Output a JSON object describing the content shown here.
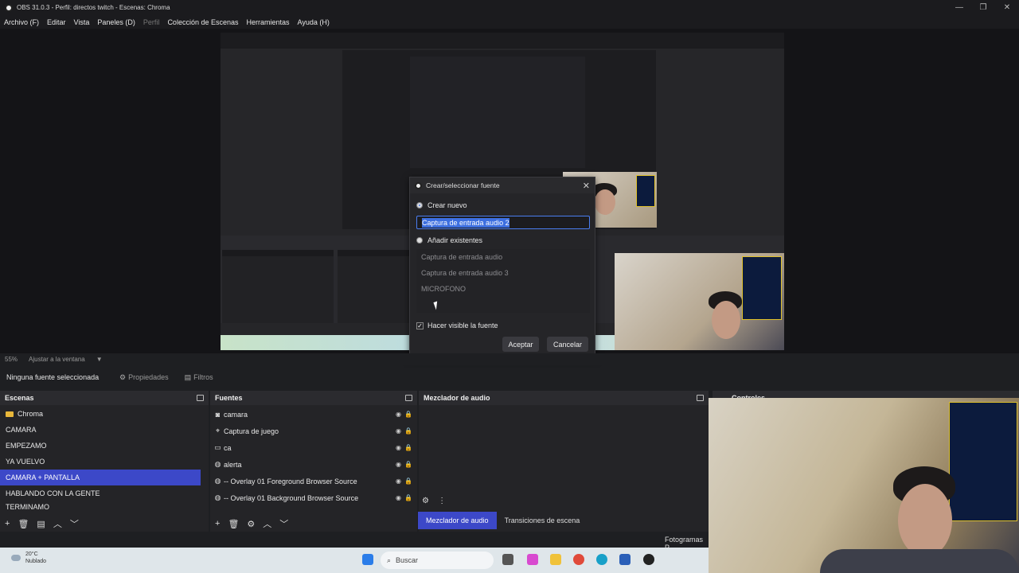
{
  "window": {
    "title": "OBS 31.0.3 - Perfil: directos twitch - Escenas: Chroma",
    "controls": [
      "—",
      "❐",
      "✕"
    ]
  },
  "menu": [
    "Archivo (F)",
    "Editar",
    "Vista",
    "Paneles (D)",
    "Perfil",
    "Colección de Escenas",
    "Herramientas",
    "Ayuda (H)"
  ],
  "dialog": {
    "title": "Crear/seleccionar fuente",
    "close": "✕",
    "create_new_label": "Crear nuevo",
    "name_value": "Captura de entrada audio 2",
    "add_existing_label": "Añadir existentes",
    "existing_sources": [
      "Captura de entrada audio",
      "Captura de entrada audio 3",
      "MICROFONO"
    ],
    "visible_label": "Hacer visible la fuente",
    "visible_checked": true,
    "accept": "Aceptar",
    "cancel": "Cancelar"
  },
  "zoom": {
    "level": "55%",
    "fit_label": "Ajustar a la ventana"
  },
  "properties_bar": {
    "selected": "Ninguna fuente seleccionada",
    "properties": "Propiedades",
    "filters": "Filtros"
  },
  "scenes": {
    "title": "Escenas",
    "items": [
      "Chroma",
      "CAMARA",
      "EMPEZAMO",
      "YA VUELVO",
      "CAMARA + PANTALLA",
      "HABLANDO CON LA GENTE",
      "TERMINAMO"
    ],
    "active_index": 4
  },
  "sources": {
    "title": "Fuentes",
    "items": [
      {
        "icon": "camera-icon",
        "label": "camara"
      },
      {
        "icon": "gamepad-icon",
        "label": "Captura de juego"
      },
      {
        "icon": "monitor-icon",
        "label": "ca"
      },
      {
        "icon": "globe-icon",
        "label": "alerta"
      },
      {
        "icon": "globe-icon",
        "label": "-- Overlay 01  Foreground Browser Source"
      },
      {
        "icon": "globe-icon",
        "label": "-- Overlay 01  Background Browser Source"
      }
    ]
  },
  "mixer": {
    "title": "Mezclador de audio",
    "tab_active": "Mezclador de audio",
    "tab_other": "Transiciones de escena"
  },
  "controls": {
    "title": "Controles"
  },
  "status": {
    "fps_label": "Fotogramas P"
  },
  "taskbar": {
    "temp": "20°C",
    "weather": "Nublado",
    "search_placeholder": "Buscar"
  },
  "colors": {
    "accent": "#3c48c8",
    "selection": "#3d6fe0",
    "background": "#1e1f22"
  }
}
